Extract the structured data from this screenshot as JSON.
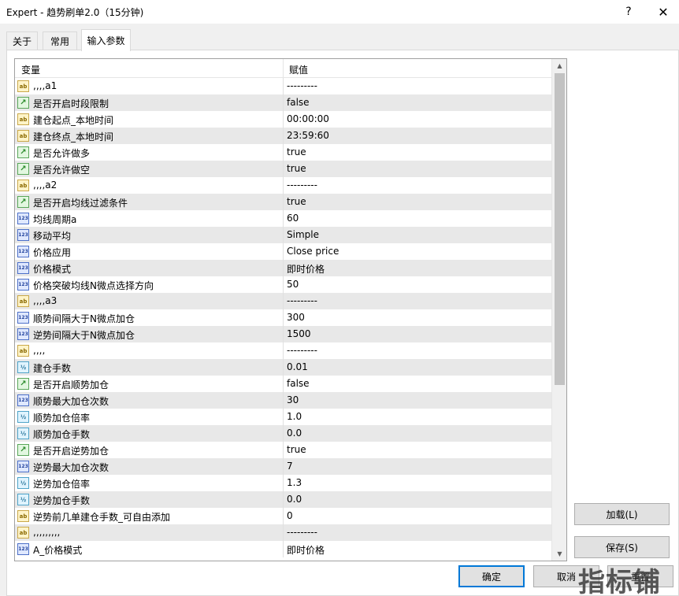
{
  "window": {
    "title": "Expert - 趋势刷单2.0（15分钟)",
    "help_glyph": "?",
    "close_glyph": "✕"
  },
  "tabs": [
    {
      "label": "关于"
    },
    {
      "label": "常用"
    },
    {
      "label": "输入参数",
      "active": true
    }
  ],
  "grid": {
    "header": {
      "variable": "变量",
      "value": "赋值"
    },
    "rows": [
      {
        "type": "str",
        "name": ",,,,a1",
        "value": "---------"
      },
      {
        "type": "bool",
        "name": "是否开启时段限制",
        "value": "false"
      },
      {
        "type": "str",
        "name": "建仓起点_本地时间",
        "value": "00:00:00"
      },
      {
        "type": "str",
        "name": "建仓终点_本地时间",
        "value": "23:59:60"
      },
      {
        "type": "bool",
        "name": "是否允许做多",
        "value": "true"
      },
      {
        "type": "bool",
        "name": "是否允许做空",
        "value": "true"
      },
      {
        "type": "str",
        "name": ",,,,a2",
        "value": "---------"
      },
      {
        "type": "bool",
        "name": "是否开启均线过滤条件",
        "value": "true"
      },
      {
        "type": "int",
        "name": "均线周期a",
        "value": "60"
      },
      {
        "type": "int",
        "name": "移动平均",
        "value": "Simple"
      },
      {
        "type": "int",
        "name": "价格应用",
        "value": "Close price"
      },
      {
        "type": "int",
        "name": "价格模式",
        "value": "即时价格"
      },
      {
        "type": "int",
        "name": "价格突破均线N微点选择方向",
        "value": "50"
      },
      {
        "type": "str",
        "name": ",,,,a3",
        "value": "---------"
      },
      {
        "type": "int",
        "name": "顺势间隔大于N微点加仓",
        "value": "300"
      },
      {
        "type": "int",
        "name": "逆势间隔大于N微点加仓",
        "value": "1500"
      },
      {
        "type": "str",
        "name": ",,,,",
        "value": "---------"
      },
      {
        "type": "dbl",
        "name": "建仓手数",
        "value": "0.01"
      },
      {
        "type": "bool",
        "name": "是否开启顺势加仓",
        "value": "false"
      },
      {
        "type": "int",
        "name": "顺势最大加仓次数",
        "value": "30"
      },
      {
        "type": "dbl",
        "name": "顺势加仓倍率",
        "value": "1.0"
      },
      {
        "type": "dbl",
        "name": "顺势加仓手数",
        "value": "0.0"
      },
      {
        "type": "bool",
        "name": "是否开启逆势加仓",
        "value": "true"
      },
      {
        "type": "int",
        "name": "逆势最大加仓次数",
        "value": "7"
      },
      {
        "type": "dbl",
        "name": "逆势加仓倍率",
        "value": "1.3"
      },
      {
        "type": "dbl",
        "name": "逆势加仓手数",
        "value": "0.0"
      },
      {
        "type": "str",
        "name": "逆势前几单建仓手数_可自由添加",
        "value": "0"
      },
      {
        "type": "str",
        "name": ",,,,,,,,,",
        "value": "---------"
      },
      {
        "type": "int",
        "name": "A_价格模式",
        "value": "即时价格"
      }
    ]
  },
  "icons": {
    "str": "ab",
    "bool": "↗",
    "int": "123",
    "dbl": "½"
  },
  "buttons": {
    "load": "加载(L)",
    "save": "保存(S)",
    "ok": "确定",
    "cancel": "取消",
    "reset": "重置"
  },
  "watermark": "指标铺"
}
